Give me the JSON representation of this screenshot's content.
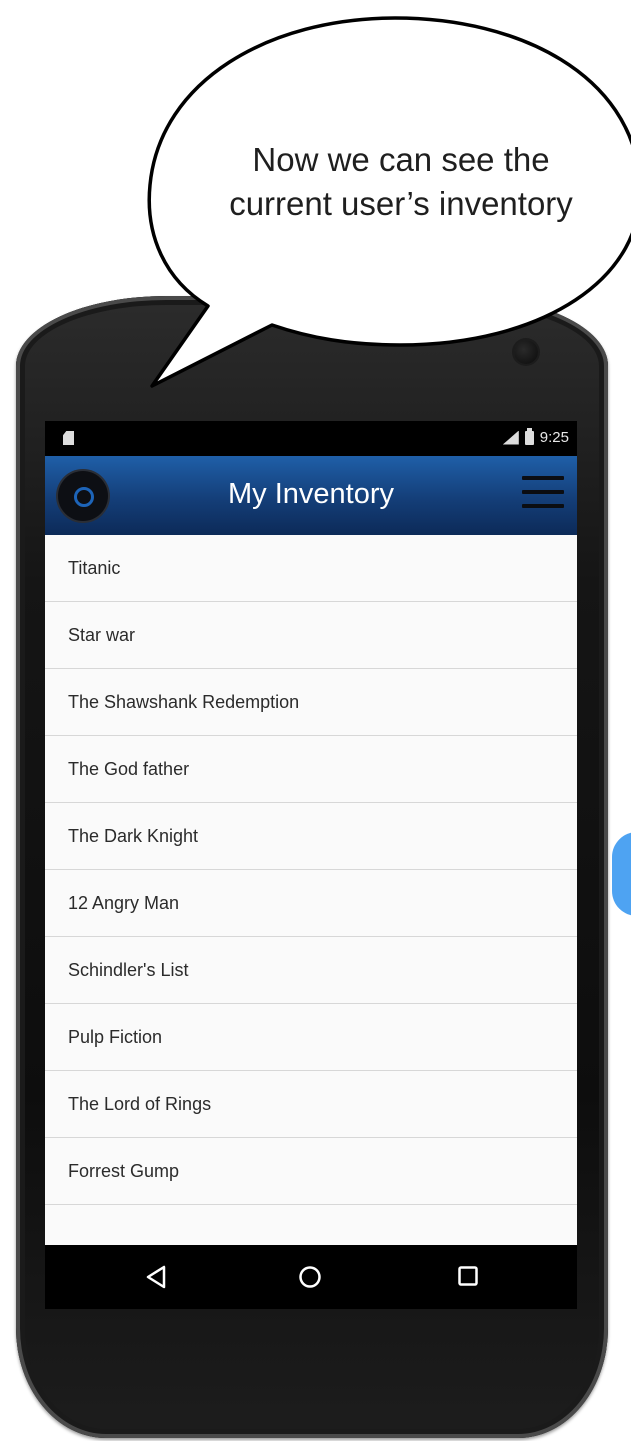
{
  "callout": {
    "line1": "Now we can see the",
    "line2": "current user’s inventory"
  },
  "status_bar": {
    "time": "9:25",
    "left_icon": "sd-card-icon",
    "signal_icon": "signal-icon",
    "battery_icon": "battery-icon"
  },
  "app_bar": {
    "title": "My Inventory",
    "logo_icon": "disc-logo-icon",
    "menu_icon": "hamburger-menu-icon",
    "color": "#1a4f94"
  },
  "inventory": {
    "items": [
      "Titanic",
      "Star war",
      "The Shawshank Redemption",
      "The God father",
      "The Dark Knight",
      "12 Angry Man",
      "Schindler's List",
      "Pulp Fiction",
      "The Lord of Rings",
      "Forrest Gump"
    ]
  },
  "nav_bar": {
    "back_icon": "back-triangle-icon",
    "home_icon": "home-circle-icon",
    "recents_icon": "recents-square-icon"
  },
  "fab": {
    "color": "#4ea3f2"
  }
}
